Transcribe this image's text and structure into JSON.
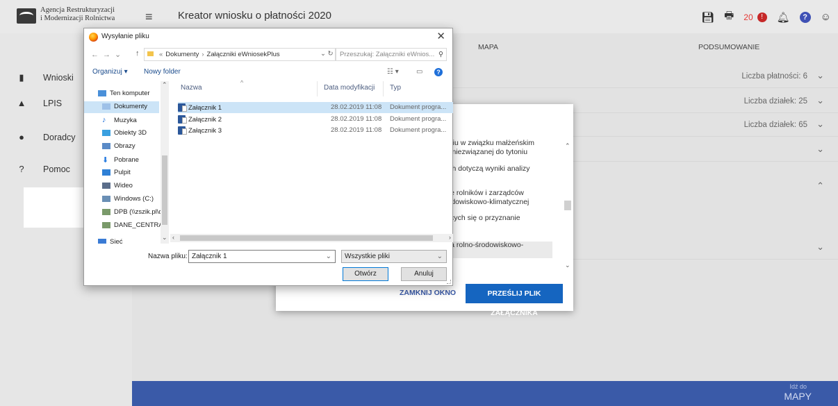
{
  "header": {
    "org_line1": "Agencja Restrukturyzacji",
    "org_line2": "i Modernizacji Rolnictwa",
    "title": "Kreator wniosku o płatności 2020",
    "notification_count": "20"
  },
  "sidebar": {
    "items": [
      {
        "label": "Wnioski",
        "icon": "clipboard-icon"
      },
      {
        "label": "LPIS",
        "icon": "mountain-icon"
      },
      {
        "label": "Doradcy",
        "icon": "person-icon"
      },
      {
        "label": "Pomoc",
        "icon": "help-icon"
      }
    ]
  },
  "main": {
    "tabs": [
      "MAPA",
      "PODSUMOWANIE"
    ],
    "rows": [
      {
        "text": "Liczba płatności: 6"
      },
      {
        "text": "Liczba działek: 25"
      },
      {
        "text": "Liczba działek: 65"
      }
    ]
  },
  "modal": {
    "list_lines": [
      "aniu w związku małżeńskim",
      "ci niezwiązanej do tytoniu",
      "ych dotyczą wyniki analizy",
      "pie rolników i zarządców",
      "rodowiskowo-klimatycznej",
      "jących się o przyznanie",
      "nia rolno-środowiskowo-"
    ],
    "close_label": "ZAMKNIJ OKNO",
    "send_label": "PRZEŚLIJ PLIK ZAŁĄCZNIKA"
  },
  "bottom_bar": {
    "line1": "Idź do",
    "line2": "MAPY"
  },
  "file_dialog": {
    "title": "Wysyłanie pliku",
    "path": [
      "Dokumenty",
      "Załączniki eWniosekPlus"
    ],
    "path_prefix": "«",
    "search_placeholder": "Przeszukaj: Załączniki eWnios...",
    "organize_label": "Organizuj ▾",
    "new_folder_label": "Nowy folder",
    "nav_items": [
      {
        "label": "Ten komputer",
        "icon": "computer-icon",
        "color": "#4a90d9"
      },
      {
        "label": "Dokumenty",
        "icon": "documents-icon",
        "color": "#9ec1e8"
      },
      {
        "label": "Muzyka",
        "icon": "music-icon",
        "color": "#1e6fd9"
      },
      {
        "label": "Obiekty 3D",
        "icon": "cube-icon",
        "color": "#3aa0e0"
      },
      {
        "label": "Obrazy",
        "icon": "pictures-icon",
        "color": "#5b8bc7"
      },
      {
        "label": "Pobrane",
        "icon": "download-icon",
        "color": "#2a7de1"
      },
      {
        "label": "Pulpit",
        "icon": "desktop-icon",
        "color": "#2f80d6"
      },
      {
        "label": "Wideo",
        "icon": "video-icon",
        "color": "#5b6d8a"
      },
      {
        "label": "Windows (C:)",
        "icon": "drive-icon",
        "color": "#6a8fb5"
      },
      {
        "label": "DPB (\\\\zszik.pl\\d",
        "icon": "network-drive-icon",
        "color": "#7a9a6a"
      },
      {
        "label": "DANE_CENTRAL",
        "icon": "network-drive-icon",
        "color": "#7a9a6a"
      },
      {
        "label": "Sieć",
        "icon": "network-icon",
        "color": "#3a7bd5"
      }
    ],
    "columns": [
      "Nazwa",
      "Data modyfikacji",
      "Typ"
    ],
    "files": [
      {
        "name": "Załącznik 1",
        "date": "28.02.2019 11:08",
        "type": "Dokument progra..."
      },
      {
        "name": "Załącznik 2",
        "date": "28.02.2019 11:08",
        "type": "Dokument progra..."
      },
      {
        "name": "Załącznik 3",
        "date": "28.02.2019 11:08",
        "type": "Dokument progra..."
      }
    ],
    "filename_label": "Nazwa pliku:",
    "filename_value": "Załącznik 1",
    "filter_value": "Wszystkie pliki",
    "open_label": "Otwórz",
    "cancel_label": "Anuluj"
  }
}
